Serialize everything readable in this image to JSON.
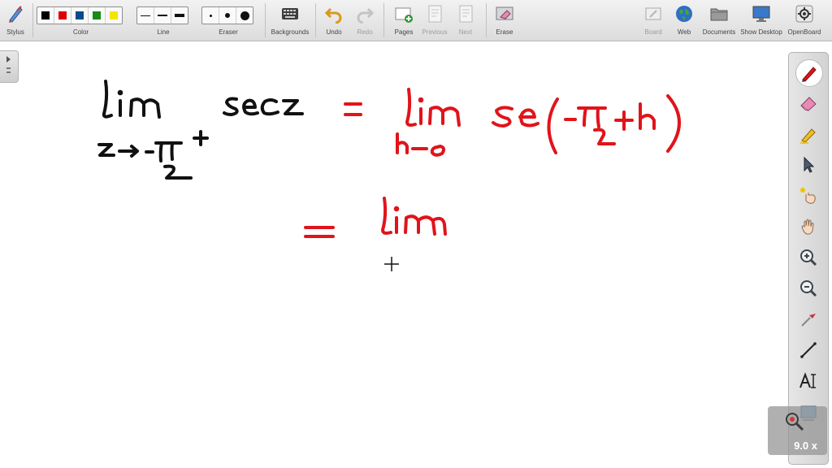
{
  "toolbar": {
    "stylus": "Stylus",
    "color": "Color",
    "line": "Line",
    "eraser": "Eraser",
    "backgrounds": "Backgrounds",
    "undo": "Undo",
    "redo": "Redo",
    "pages": "Pages",
    "previous": "Previous",
    "next": "Next",
    "erase": "Erase",
    "board": "Board",
    "web": "Web",
    "documents": "Documents",
    "show_desktop": "Show Desktop",
    "openboard": "OpenBoard"
  },
  "palette": [
    "#000000",
    "#e00000",
    "#0b4a8a",
    "#1a8a1a",
    "#f2e600"
  ],
  "ink_colors": {
    "black": "#111111",
    "red": "#e0141a"
  },
  "zoom": {
    "label": "9.0 x"
  },
  "right_tools": [
    "pen-icon",
    "eraser-icon",
    "highlighter-icon",
    "pointer-icon",
    "laser-icon",
    "hand-icon",
    "zoom-in-icon",
    "zoom-out-icon",
    "capture-icon",
    "line-icon",
    "text-icon"
  ]
}
